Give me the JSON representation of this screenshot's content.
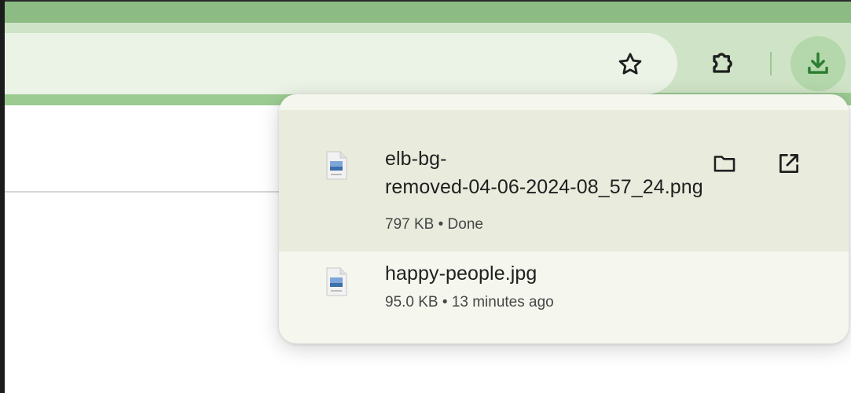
{
  "toolbar": {
    "bookmark_icon": "star-icon",
    "extensions_icon": "puzzle-piece-icon",
    "downloads_icon": "download-icon"
  },
  "colors": {
    "tabstrip": "#8cbc84",
    "toolbar": "#cfe3c6",
    "omnibox": "#ebf2e6",
    "downloads_button_bg": "#b4d8ab",
    "accent_icon": "#2e7d32",
    "bubble_bg": "#f5f6ee",
    "selected_row_bg": "#e9ecdd"
  },
  "downloads": {
    "items": [
      {
        "file_name_line1": "elb-bg-",
        "file_name_line2": "removed-04-06-2024-08_57_24.png",
        "status": "797 KB • Done",
        "file_icon": "image-file-icon",
        "actions": [
          "folder-icon",
          "open-external-icon"
        ]
      },
      {
        "file_name": "happy-people.jpg",
        "status": "95.0 KB • 13 minutes ago",
        "file_icon": "image-file-icon"
      }
    ]
  }
}
